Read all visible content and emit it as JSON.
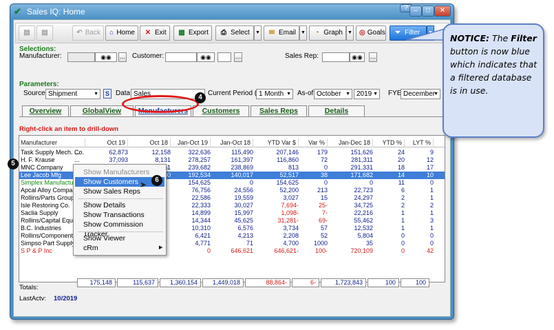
{
  "window": {
    "title": "Sales IQ: Home",
    "minimize": "–",
    "maximize": "□",
    "close": "✕",
    "help": "?"
  },
  "toolbar": {
    "back": "Back",
    "home": "Home",
    "exit": "Exit",
    "export": "Export",
    "select": "Select",
    "email": "Email",
    "graph": "Graph",
    "goals": "Goals",
    "filter": "Filter"
  },
  "selections": {
    "title": "Selections:",
    "manufacturer_label": "Manufacturer:",
    "customer_label": "Customer:",
    "sales_rep_label": "Sales Rep:"
  },
  "parameters": {
    "title": "Parameters:",
    "source_label": "Source",
    "source_value": "Shipment",
    "s_button": "S",
    "data_label": "Data",
    "data_value": "Sales",
    "period_label": "Current Period (CP)",
    "period_value": "1 Month",
    "asof_label": "As-of",
    "month_value": "October",
    "year_value": "2019",
    "fye_label": "FYE",
    "fye_value": "December"
  },
  "tabs": [
    "Overview",
    "GlobalView",
    "Manufacturers",
    "Customers",
    "Sales Reps",
    "Details"
  ],
  "hint": "Right-click an item to drill-down",
  "grid": {
    "columns": [
      "Manufacturer",
      "Oct 19",
      "Oct 18",
      "Jan-Oct 19",
      "Jan-Oct 18",
      "YTD Var $",
      "Var %",
      "Jan-Dec 18",
      "YTD %",
      "LYT %"
    ],
    "rows": [
      [
        "Task Supply Mech. Co.",
        "62,873",
        "12,158",
        "322,636",
        "115,490",
        "207,146",
        "179",
        "151,626",
        "24",
        "9"
      ],
      [
        "H. F. Krause",
        "37,093",
        "8,131",
        "278,257",
        "161,397",
        "116,860",
        "72",
        "281,311",
        "20",
        "12"
      ],
      [
        "MNC Company",
        "43,367",
        "9,951",
        "239,682",
        "238,869",
        "813",
        "0",
        "291,331",
        "18",
        "17"
      ],
      [
        "Lee Jacob Mfg",
        "20,152",
        "16,080",
        "192,534",
        "140,017",
        "52,517",
        "38",
        "171,682",
        "14",
        "10"
      ],
      [
        "Simplex Manufacturing",
        "",
        "",
        "154,625",
        "0",
        "154,625",
        "0",
        "0",
        "11",
        "0"
      ],
      [
        "Apcal Alloy Company",
        "",
        "",
        "76,756",
        "24,556",
        "52,200",
        "213",
        "22,723",
        "6",
        "1"
      ],
      [
        "Rollins/Parts Group",
        "",
        "",
        "22,586",
        "19,559",
        "3,027",
        "15",
        "24,297",
        "2",
        "1"
      ],
      [
        "Isle Restoring Co.",
        "",
        "",
        "22,333",
        "30,027",
        "7,694-",
        "25-",
        "34,725",
        "2",
        "2"
      ],
      [
        "Saclia Supply",
        "",
        "",
        "14,899",
        "15,997",
        "1,098-",
        "7-",
        "22,216",
        "1",
        "1"
      ],
      [
        "Rollins/Capital Equip",
        "",
        "",
        "14,344",
        "45,625",
        "31,281-",
        "69-",
        "55,462",
        "1",
        "3"
      ],
      [
        "B.C. Industries",
        "",
        "",
        "10,310",
        "6,576",
        "3,734",
        "57",
        "12,532",
        "1",
        "1"
      ],
      [
        "Rollins/Components G",
        "",
        "",
        "6,421",
        "4,213",
        "2,208",
        "52",
        "5,804",
        "0",
        "0"
      ],
      [
        "Simpso Part Supply",
        "",
        "",
        "4,771",
        "71",
        "4,700",
        "1000",
        "35",
        "0",
        "0"
      ],
      [
        "S P & P Inc",
        "",
        "",
        "0",
        "646,621",
        "646,621-",
        "100-",
        "720,109",
        "0",
        "42"
      ]
    ]
  },
  "totals": {
    "label": "Totals:",
    "values": [
      "175,148",
      "115,637",
      "1,360,154",
      "1,449,018",
      "88,864-",
      "6-",
      "1,723,843",
      "100",
      "100"
    ],
    "lastactv_label": "LastActv:",
    "lastactv_value": "10/2019"
  },
  "context_menu": {
    "items": [
      "Show Manufacturers",
      "Show Customers",
      "Show Sales Reps",
      "Show Details",
      "Show Transactions",
      "Show Commission Tracker",
      "Show Viewer",
      "cRm"
    ]
  },
  "callouts": {
    "b4": "4",
    "b5": "5",
    "b6": "6"
  },
  "notice": {
    "lead": "NOTICE:",
    "t1": " The ",
    "bold": "Filter",
    "t2": " button is now blue which indicates that a filtered database is in use."
  },
  "colors": {
    "accent_blue": "#3e7ed8",
    "filter_blue": "#1e74d8",
    "highlight_red": "#e01818",
    "section_green": "#1f7a1f"
  }
}
